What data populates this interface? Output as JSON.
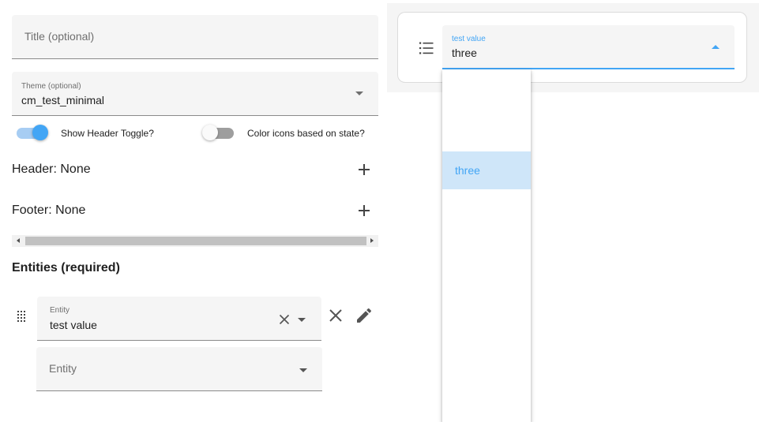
{
  "editor": {
    "title_field": {
      "placeholder": "Title (optional)",
      "value": ""
    },
    "theme_field": {
      "label": "Theme (optional)",
      "value": "cm_test_minimal"
    },
    "toggles": [
      {
        "label": "Show Header Toggle?",
        "on": true
      },
      {
        "label": "Color icons based on state?",
        "on": false
      }
    ],
    "header_label": "Header: None",
    "footer_label": "Footer: None",
    "entities_title": "Entities (required)",
    "entity_row": {
      "label": "Entity",
      "value": "test value"
    },
    "new_entity": {
      "label": "Entity"
    }
  },
  "preview": {
    "select": {
      "label": "test value",
      "value": "three"
    },
    "menu_items": [
      {
        "label": "",
        "selected": false
      },
      {
        "label": "",
        "selected": false
      },
      {
        "label": "three",
        "selected": true
      }
    ]
  },
  "colors": {
    "accent": "#42a5f5",
    "field_bg": "#f5f5f5",
    "selected_bg": "#cfe6f9"
  },
  "icons": {
    "list_icon": "format-list-bulleted-icon",
    "clear_icon": "close-icon",
    "edit_icon": "pencil-icon",
    "drag_icon": "drag-handle-icon",
    "add_icon": "plus-icon"
  }
}
